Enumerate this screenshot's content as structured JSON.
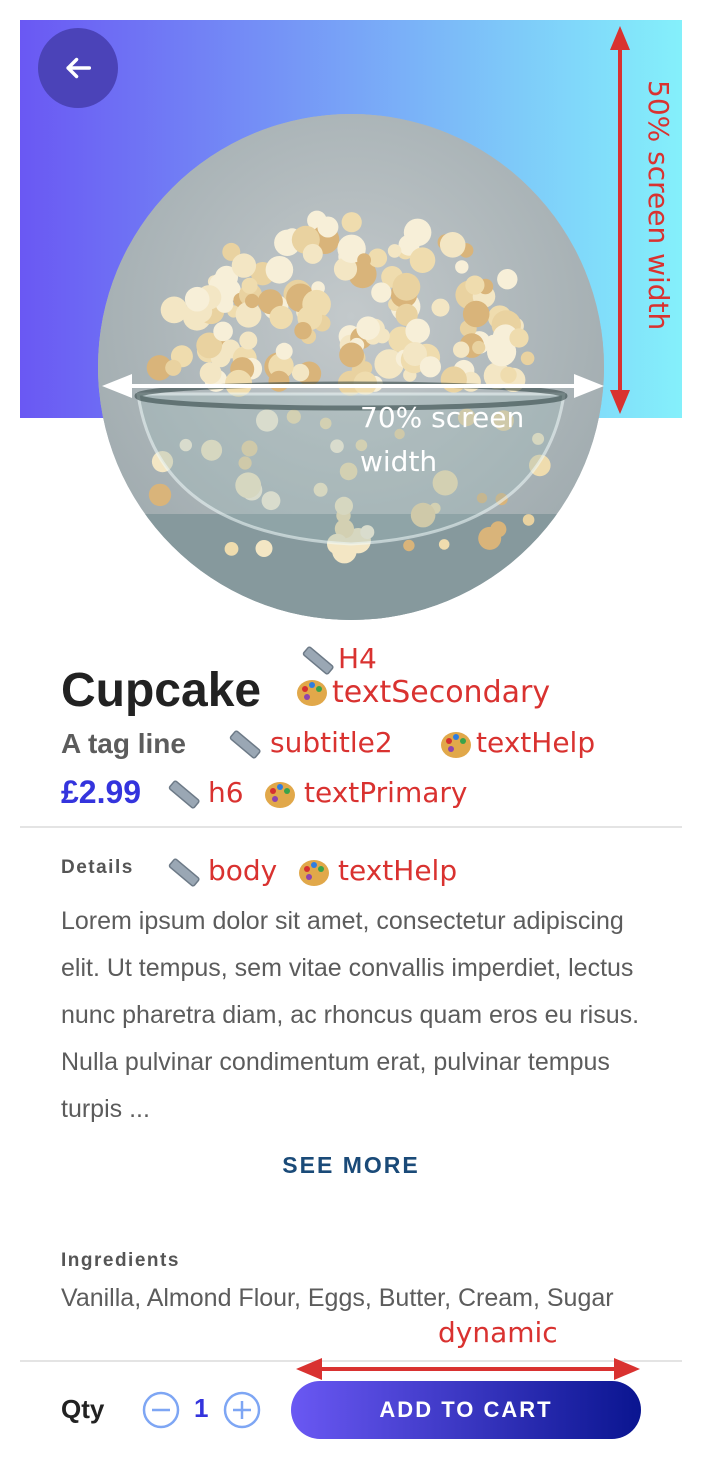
{
  "product": {
    "name": "Cupcake",
    "tagline": "A tag line",
    "price": "£2.99"
  },
  "details": {
    "label": "Details",
    "text": "Lorem ipsum dolor sit amet, consectetur adipiscing elit. Ut tempus, sem vitae convallis imperdiet, lectus nunc pharetra diam, ac rhoncus quam eros eu risus. Nulla pulvinar condimentum erat, pulvinar tempus turpis ...",
    "see_more": "SEE MORE"
  },
  "ingredients": {
    "label": "Ingredients",
    "text": "Vanilla, Almond Flour, Eggs, Butter, Cream, Sugar"
  },
  "cart": {
    "qty_label": "Qty",
    "qty_value": "1",
    "add_to_cart": "ADD TO CART"
  },
  "annotations": {
    "screen_height": "50% screen width",
    "image_width_line1": "70% screen",
    "image_width_line2": "width",
    "title_size": "H4",
    "title_color": "textSecondary",
    "tagline_size": "subtitle2",
    "tagline_color": "textHelp",
    "price_size": "h6",
    "price_color": "textPrimary",
    "details_size": "body",
    "details_color": "textHelp",
    "cart_width": "dynamic"
  },
  "icons": {
    "back": "arrow-left-icon",
    "decrement": "minus-circle-icon",
    "increment": "plus-circle-icon",
    "ruler": "ruler-icon",
    "palette": "palette-icon"
  },
  "colors": {
    "gradient_start": "#6a58f3",
    "gradient_end": "#84f0fb",
    "primary": "#3434dd",
    "annotation": "#d93230",
    "button_end": "#0a1590"
  }
}
